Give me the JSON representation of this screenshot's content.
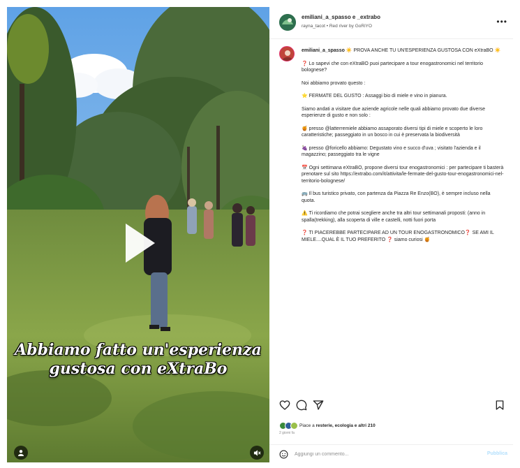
{
  "media": {
    "caption_lines": [
      "Abbiamo fatto un'esperienza",
      "gustosa con eXtraBo"
    ],
    "play_icon": "play-icon",
    "audio_icon": "speaker-muted-icon"
  },
  "header": {
    "username": "emiliani_a_spasso e _extrabo",
    "subtitle": "rayna_tacot • Red river by GoRiYO",
    "more_icon": "more-horizontal-icon"
  },
  "caption": {
    "username": "emiliani_a_spasso",
    "headline": "☀️ PROVA ANCHE TU UN'ESPERIENZA GUSTOSA CON eXtraBO ☀️",
    "paragraphs": [
      "❓ Lo sapevi che con eXtraBO puoi partecipare a tour enogastronomici nel territorio bolognese?",
      "Noi abbiamo provato questo :",
      "⭐ FERMATE DEL GUSTO : Assaggi bio di miele e vino in pianura.",
      "Siamo andati a visitare due aziende agricole nelle quali abbiamo provato due diverse esperienze di gusto e non solo :",
      "🍯 presso @latterremiele abbiamo assaporato diversi tipi di miele e scoperto le loro caratteristiche; passeggiato in un bosco in cui è preservata la biodiversità",
      "🍇 presso @foricello abbiamo: Degustato vino e succo d'uva ; visitato l'azienda e il magazzino; passeggiato tra le vigne",
      "📅 Ogni settimana eXtraBO, propone diversi tour enogastronomici : per partecipare ti basterà prenotare sul sito https://extrabo.com/it/attivita/le-fermate-del-gusto-tour-enogastronomici-nel-territorio-bolognese/",
      "🚌 Il bus turistico privato, con partenza da Piazza Re Enzo(BO), è sempre incluso nella quota.",
      "⚠️ Ti ricordiamo che potrai scegliere anche tra altri tour settimanali proposti: (anno in spalla(trekking), alla scoperta di ville e castelli, notti fuori porta",
      "❓ TI PIACEREBBE PARTECIPARE AD UN TOUR ENOGASTRONOMICO❓ SE AMI IL MIELE....QUAL È IL TUO PREFERITO ❓ siamo curiosi 🍯"
    ]
  },
  "actions": {
    "like_icon": "heart-icon",
    "comment_icon": "comment-icon",
    "share_icon": "send-icon",
    "save_icon": "bookmark-icon"
  },
  "likes": {
    "text_prefix": "Piace a ",
    "liker": "resterie, ecologia e altri 210",
    "date": "2 giorni fa"
  },
  "comment": {
    "placeholder": "Aggiungi un commento...",
    "post_label": "Pubblica"
  }
}
